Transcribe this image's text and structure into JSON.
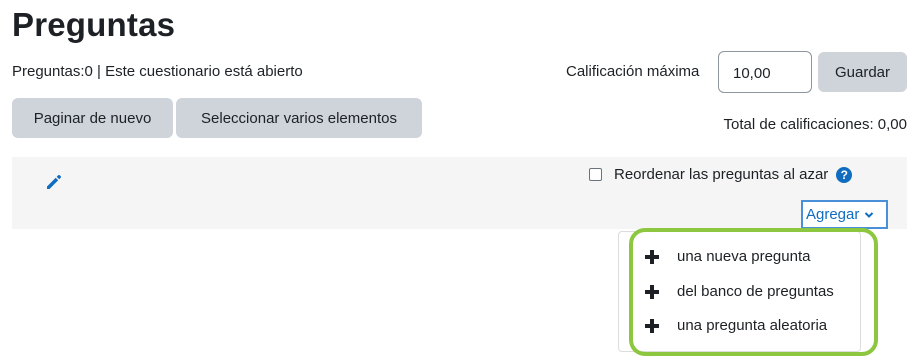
{
  "page": {
    "title": "Preguntas",
    "status": "Preguntas:0 | Este cuestionario está abierto"
  },
  "grade": {
    "label": "Calificación máxima",
    "value": "10,00",
    "save_label": "Guardar",
    "total": "Total de calificaciones: 0,00"
  },
  "toolbar": {
    "repaginate_label": "Paginar de nuevo",
    "select_multiple_label": "Seleccionar varios elementos"
  },
  "section": {
    "shuffle_label": "Reordenar las preguntas al azar",
    "shuffle_checked": false,
    "help_icon": "?",
    "add_label": "Agregar",
    "edit_icon": "pencil-icon"
  },
  "add_menu": {
    "items": [
      {
        "label": "una nueva pregunta",
        "icon": "plus-icon"
      },
      {
        "label": "del banco de preguntas",
        "icon": "plus-icon"
      },
      {
        "label": "una pregunta aleatoria",
        "icon": "plus-icon"
      }
    ]
  },
  "colors": {
    "accent": "#0f6cbf",
    "button_bg": "#ced4da",
    "panel_bg": "#f5f5f5",
    "highlight": "#8dc63f",
    "focus_border": "#4a90d9"
  }
}
